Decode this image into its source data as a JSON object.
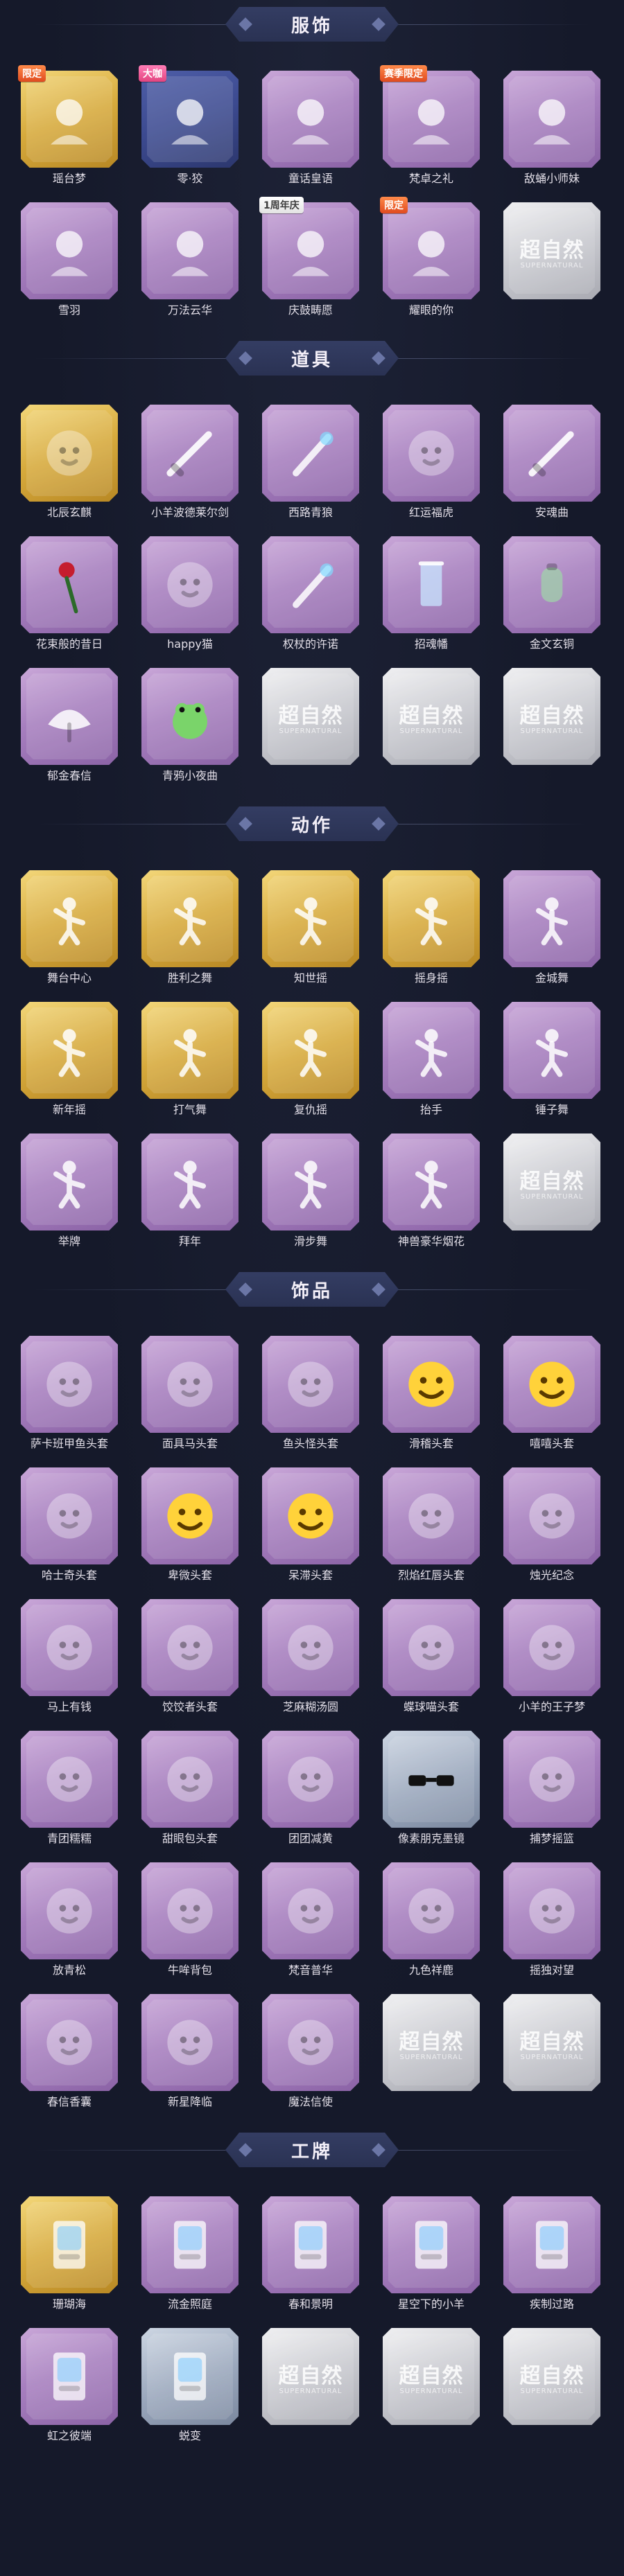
{
  "colors": {
    "bg": "#15192a",
    "header_bg": "#2a3253",
    "purple": "#a77fbf",
    "gold": "#d7aa3c",
    "blue": "#3c4a90",
    "silver": "#9aa7bc",
    "gray": "#c9cad0"
  },
  "placeholder": {
    "main": "超自然",
    "sub": "SUPERNATURAL"
  },
  "sections": [
    {
      "title": "服饰",
      "items": [
        {
          "label": "瑶台梦",
          "tier": "gold",
          "badge": "限定",
          "icon": "character-portrait-icon"
        },
        {
          "label": "零·狡",
          "tier": "blue",
          "badge": "大咖",
          "icon": "character-portrait-icon"
        },
        {
          "label": "童话皇语",
          "tier": "purple",
          "badge": "",
          "icon": "character-portrait-icon"
        },
        {
          "label": "梵卓之礼",
          "tier": "purple",
          "badge": "赛季限定",
          "icon": "character-portrait-icon"
        },
        {
          "label": "敌蛹小师妹",
          "tier": "purple",
          "badge": "",
          "icon": "character-portrait-icon"
        },
        {
          "label": "雪羽",
          "tier": "purple",
          "badge": "",
          "icon": "character-portrait-icon"
        },
        {
          "label": "万法云华",
          "tier": "purple",
          "badge": "",
          "icon": "character-portrait-icon"
        },
        {
          "label": "庆鼓畴愿",
          "tier": "purple",
          "badge": "1周年庆",
          "icon": "character-portrait-icon"
        },
        {
          "label": "耀眼的你",
          "tier": "purple",
          "badge": "限定",
          "icon": "character-portrait-icon"
        },
        {
          "label": "",
          "tier": "gray",
          "badge": "",
          "icon": "placeholder-icon"
        }
      ]
    },
    {
      "title": "道具",
      "items": [
        {
          "label": "北辰玄麒",
          "tier": "gold",
          "badge": "",
          "icon": "dragon-icon"
        },
        {
          "label": "小羊波德莱尔剑",
          "tier": "purple",
          "badge": "",
          "icon": "sword-icon"
        },
        {
          "label": "西路青狼",
          "tier": "purple",
          "badge": "",
          "icon": "staff-icon"
        },
        {
          "label": "红运福虎",
          "tier": "purple",
          "badge": "",
          "icon": "tiger-icon"
        },
        {
          "label": "安魂曲",
          "tier": "purple",
          "badge": "",
          "icon": "blade-icon"
        },
        {
          "label": "花束般的昔日",
          "tier": "purple",
          "badge": "",
          "icon": "rose-icon"
        },
        {
          "label": "happy猫",
          "tier": "purple",
          "badge": "",
          "icon": "cat-icon"
        },
        {
          "label": "权杖的许诺",
          "tier": "purple",
          "badge": "",
          "icon": "scepter-icon"
        },
        {
          "label": "招魂幡",
          "tier": "purple",
          "badge": "",
          "icon": "banner-icon"
        },
        {
          "label": "金文玄铜",
          "tier": "purple",
          "badge": "",
          "icon": "lantern-icon"
        },
        {
          "label": "郁金春信",
          "tier": "purple",
          "badge": "",
          "icon": "fan-icon"
        },
        {
          "label": "青鸦小夜曲",
          "tier": "purple",
          "badge": "",
          "icon": "frog-icon"
        },
        {
          "label": "",
          "tier": "gray",
          "badge": "",
          "icon": "placeholder-icon"
        },
        {
          "label": "",
          "tier": "gray",
          "badge": "",
          "icon": "placeholder-icon"
        },
        {
          "label": "",
          "tier": "gray",
          "badge": "",
          "icon": "placeholder-icon"
        }
      ]
    },
    {
      "title": "动作",
      "items": [
        {
          "label": "舞台中心",
          "tier": "gold",
          "badge": "",
          "icon": "pose-icon"
        },
        {
          "label": "胜利之舞",
          "tier": "gold",
          "badge": "",
          "icon": "pose-icon"
        },
        {
          "label": "知世摇",
          "tier": "gold",
          "badge": "",
          "icon": "pose-icon"
        },
        {
          "label": "摇身摇",
          "tier": "gold",
          "badge": "",
          "icon": "pose-icon"
        },
        {
          "label": "金城舞",
          "tier": "purple",
          "badge": "",
          "icon": "pose-icon"
        },
        {
          "label": "新年摇",
          "tier": "gold",
          "badge": "",
          "icon": "pose-icon"
        },
        {
          "label": "打气舞",
          "tier": "gold",
          "badge": "",
          "icon": "pose-icon"
        },
        {
          "label": "复仇摇",
          "tier": "gold",
          "badge": "",
          "icon": "pose-icon"
        },
        {
          "label": "抬手",
          "tier": "purple",
          "badge": "",
          "icon": "pose-icon"
        },
        {
          "label": "锤子舞",
          "tier": "purple",
          "badge": "",
          "icon": "pose-icon"
        },
        {
          "label": "举牌",
          "tier": "purple",
          "badge": "",
          "icon": "pose-icon"
        },
        {
          "label": "拜年",
          "tier": "purple",
          "badge": "",
          "icon": "pose-icon"
        },
        {
          "label": "滑步舞",
          "tier": "purple",
          "badge": "",
          "icon": "pose-icon"
        },
        {
          "label": "神兽豪华烟花",
          "tier": "purple",
          "badge": "",
          "icon": "pose-icon"
        },
        {
          "label": "",
          "tier": "gray",
          "badge": "",
          "icon": "placeholder-icon"
        }
      ]
    },
    {
      "title": "饰品",
      "items": [
        {
          "label": "萨卡班甲鱼头套",
          "tier": "purple",
          "badge": "",
          "icon": "fish-head-icon"
        },
        {
          "label": "面具马头套",
          "tier": "purple",
          "badge": "",
          "icon": "horse-head-icon"
        },
        {
          "label": "鱼头怪头套",
          "tier": "purple",
          "badge": "",
          "icon": "fish-monster-icon"
        },
        {
          "label": "滑稽头套",
          "tier": "purple",
          "badge": "",
          "icon": "emoji-face-icon"
        },
        {
          "label": "嘻嘻头套",
          "tier": "purple",
          "badge": "",
          "icon": "grin-face-icon"
        },
        {
          "label": "哈士奇头套",
          "tier": "purple",
          "badge": "",
          "icon": "dog-head-icon"
        },
        {
          "label": "卑微头套",
          "tier": "purple",
          "badge": "",
          "icon": "sad-face-icon"
        },
        {
          "label": "呆滞头套",
          "tier": "purple",
          "badge": "",
          "icon": "stare-face-icon"
        },
        {
          "label": "烈焰红唇头套",
          "tier": "purple",
          "badge": "",
          "icon": "pikachu-icon"
        },
        {
          "label": "烛光纪念",
          "tier": "purple",
          "badge": "",
          "icon": "candle-icon"
        },
        {
          "label": "马上有钱",
          "tier": "purple",
          "badge": "",
          "icon": "bird-icon"
        },
        {
          "label": "饺饺者头套",
          "tier": "purple",
          "badge": "",
          "icon": "cloud-icon"
        },
        {
          "label": "芝麻糊汤圆",
          "tier": "purple",
          "badge": "",
          "icon": "dumpling-icon"
        },
        {
          "label": "蝶球喵头套",
          "tier": "purple",
          "badge": "",
          "icon": "cat-head-icon"
        },
        {
          "label": "小羊的王子梦",
          "tier": "purple",
          "badge": "",
          "icon": "sheep-icon"
        },
        {
          "label": "青团糯糯",
          "tier": "purple",
          "badge": "",
          "icon": "green-ball-icon"
        },
        {
          "label": "甜眼包头套",
          "tier": "purple",
          "badge": "",
          "icon": "bun-icon"
        },
        {
          "label": "团团减黄",
          "tier": "purple",
          "badge": "",
          "icon": "fox-icon"
        },
        {
          "label": "像素朋克墨镜",
          "tier": "silver",
          "badge": "",
          "icon": "sunglasses-icon"
        },
        {
          "label": "捕梦摇篮",
          "tier": "purple",
          "badge": "",
          "icon": "doll-icon"
        },
        {
          "label": "放青松",
          "tier": "purple",
          "badge": "",
          "icon": "bonsai-icon"
        },
        {
          "label": "牛哞背包",
          "tier": "purple",
          "badge": "",
          "icon": "cow-icon"
        },
        {
          "label": "梵音普华",
          "tier": "purple",
          "badge": "",
          "icon": "doll-icon"
        },
        {
          "label": "九色祥鹿",
          "tier": "purple",
          "badge": "",
          "icon": "deer-icon"
        },
        {
          "label": "摇独对望",
          "tier": "purple",
          "badge": "",
          "icon": "figure-icon"
        },
        {
          "label": "春信香囊",
          "tier": "purple",
          "badge": "",
          "icon": "sachet-icon"
        },
        {
          "label": "新星降临",
          "tier": "purple",
          "badge": "",
          "icon": "keychain-icon"
        },
        {
          "label": "魔法信使",
          "tier": "purple",
          "badge": "",
          "icon": "mouse-icon"
        },
        {
          "label": "",
          "tier": "gray",
          "badge": "",
          "icon": "placeholder-icon"
        },
        {
          "label": "",
          "tier": "gray",
          "badge": "",
          "icon": "placeholder-icon"
        }
      ]
    },
    {
      "title": "工牌",
      "items": [
        {
          "label": "珊瑚海",
          "tier": "gold",
          "badge": "",
          "icon": "card-icon"
        },
        {
          "label": "流金照庭",
          "tier": "purple",
          "badge": "",
          "icon": "card-icon"
        },
        {
          "label": "春和景明",
          "tier": "purple",
          "badge": "",
          "icon": "card-icon"
        },
        {
          "label": "星空下的小羊",
          "tier": "purple",
          "badge": "",
          "icon": "card-icon"
        },
        {
          "label": "疾制过路",
          "tier": "purple",
          "badge": "",
          "icon": "card-icon"
        },
        {
          "label": "虹之彼端",
          "tier": "purple",
          "badge": "",
          "icon": "card-icon"
        },
        {
          "label": "蜕变",
          "tier": "silver",
          "badge": "",
          "icon": "card-icon"
        },
        {
          "label": "",
          "tier": "gray",
          "badge": "",
          "icon": "placeholder-icon"
        },
        {
          "label": "",
          "tier": "gray",
          "badge": "",
          "icon": "placeholder-icon"
        },
        {
          "label": "",
          "tier": "gray",
          "badge": "",
          "icon": "placeholder-icon"
        }
      ]
    }
  ]
}
